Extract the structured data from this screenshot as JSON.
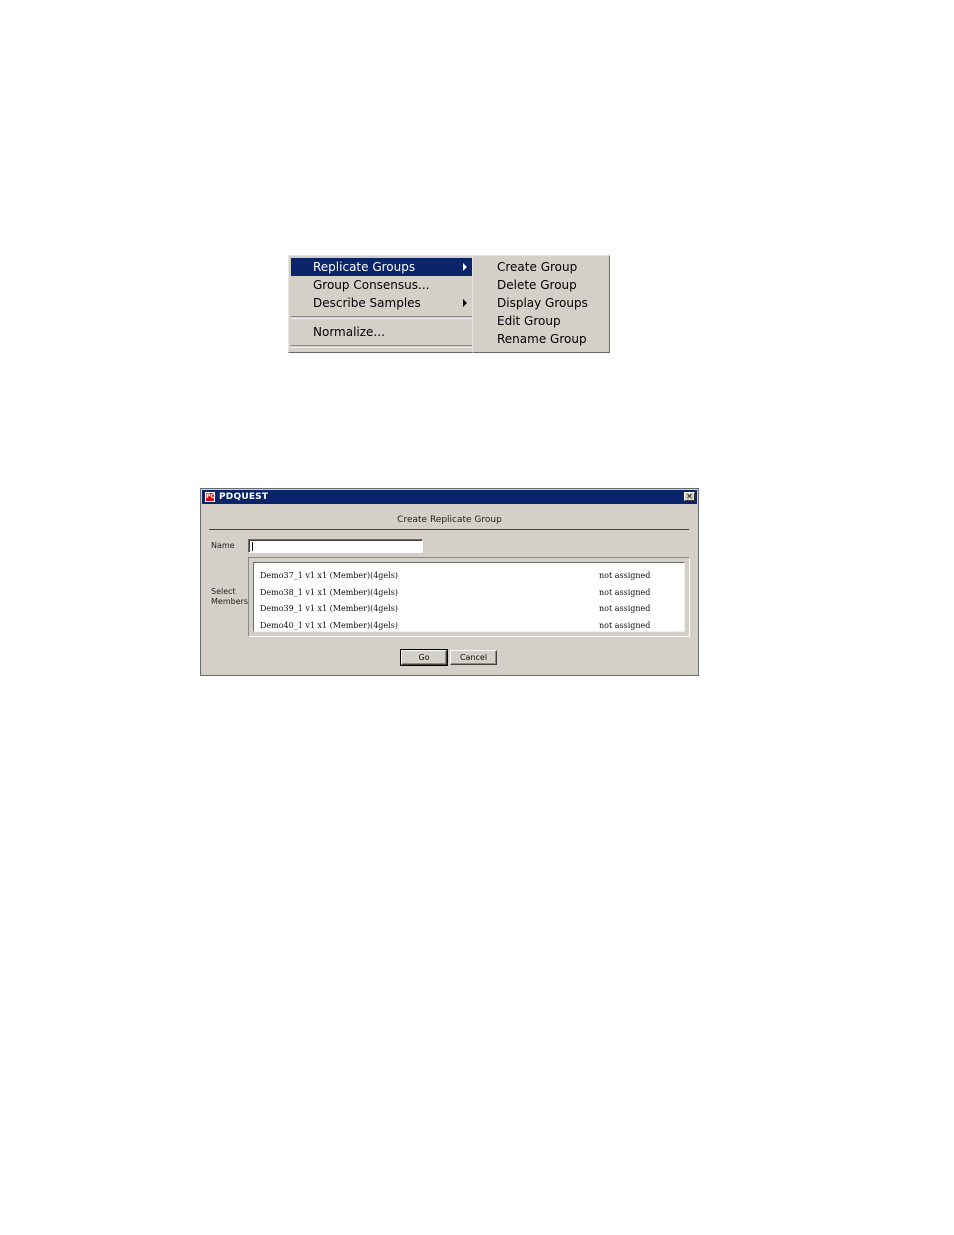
{
  "menu": {
    "items": [
      {
        "label": "Replicate Groups"
      },
      {
        "label": "Group Consensus..."
      },
      {
        "label": "Describe Samples"
      },
      {
        "label": "Normalize..."
      }
    ],
    "submenu": [
      {
        "label": "Create Group"
      },
      {
        "label": "Delete Group"
      },
      {
        "label": "Display Groups"
      },
      {
        "label": "Edit Group"
      },
      {
        "label": "Rename Group"
      }
    ]
  },
  "dialog": {
    "window_title": "PDQUEST",
    "app_icon_text": "PQ",
    "close_glyph": "✕",
    "heading": "Create Replicate Group",
    "name_label": "Name",
    "name_value": "",
    "select_label_1": "Select",
    "select_label_2": "Members",
    "members": [
      {
        "name": "Demo37_1 v1 x1 (Member)(4gels)",
        "status": "not assigned"
      },
      {
        "name": "Demo38_1 v1 x1 (Member)(4gels)",
        "status": "not assigned"
      },
      {
        "name": "Demo39_1 v1 x1 (Member)(4gels)",
        "status": "not assigned"
      },
      {
        "name": "Demo40_1 v1 x1 (Member)(4gels)",
        "status": "not assigned"
      }
    ],
    "go_label": "Go",
    "cancel_label": "Cancel"
  },
  "colors": {
    "menu_bg": "#d4d0c8",
    "highlight": "#0a246a",
    "titlebar": "#0a246a"
  }
}
